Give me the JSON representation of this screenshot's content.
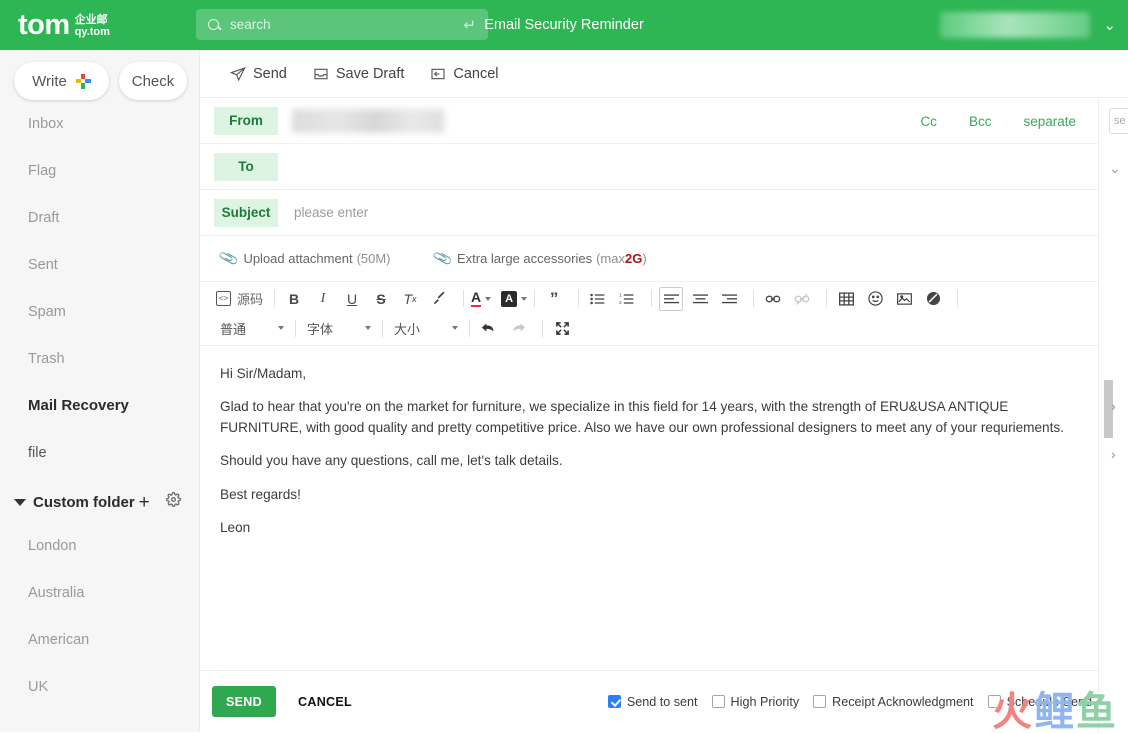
{
  "brand": {
    "logo_word": "tom",
    "logo_line1": "企业邮",
    "logo_line2": "qy.tom",
    "accent_green": "#2eb554",
    "send_green": "#2fa84f",
    "checkbox_blue": "#2a7fff",
    "warn_red": "#b3121a"
  },
  "header": {
    "title": "Email Security Reminder",
    "search_placeholder": "search",
    "search_value": "",
    "search_enter_icon": "enter-arrow-icon",
    "search_icon": "search-icon",
    "account_caret_icon": "chevron-down-icon"
  },
  "sidebar": {
    "write_label": "Write",
    "write_icon": "plus-icon",
    "check_label": "Check",
    "items": [
      {
        "label": "Inbox",
        "style": "muted"
      },
      {
        "label": "Flag",
        "style": "muted"
      },
      {
        "label": "Draft",
        "style": "muted"
      },
      {
        "label": "Sent",
        "style": "muted"
      },
      {
        "label": "Spam",
        "style": "muted"
      },
      {
        "label": "Trash",
        "style": "muted"
      },
      {
        "label": "Mail Recovery",
        "style": "strong"
      },
      {
        "label": "file",
        "style": "dark"
      }
    ],
    "custom_folder": {
      "label": "Custom folder",
      "caret_icon": "triangle-down-icon",
      "add_icon": "plus-icon",
      "settings_icon": "gear-icon",
      "children": [
        {
          "label": "London"
        },
        {
          "label": "Australia"
        },
        {
          "label": "American"
        },
        {
          "label": "UK"
        }
      ]
    }
  },
  "action_bar": {
    "send_label": "Send",
    "send_icon": "paper-plane-icon",
    "save_draft_label": "Save Draft",
    "save_draft_icon": "inbox-tray-icon",
    "cancel_label": "Cancel",
    "cancel_icon": "back-arrow-box-icon"
  },
  "compose": {
    "from_label": "From",
    "from_value": "",
    "to_label": "To",
    "to_value": "",
    "to_placeholder": "",
    "subject_label": "Subject",
    "subject_value": "",
    "subject_placeholder": "please enter",
    "cc_label": "Cc",
    "bcc_label": "Bcc",
    "separate_label": "separate",
    "attachments": {
      "upload_label": "Upload attachment",
      "upload_limit": "(50M)",
      "large_label": "Extra large accessories",
      "large_limit_prefix": "(max ",
      "large_limit_value": "2G",
      "large_limit_suffix": ")",
      "clip_icon": "paperclip-icon"
    }
  },
  "editor_toolbar": {
    "source_label": "源码",
    "source_icon": "code-brackets-icon",
    "buttons": [
      {
        "name": "bold-button",
        "glyph": "B"
      },
      {
        "name": "italic-button",
        "glyph": "I"
      },
      {
        "name": "underline-button",
        "glyph": "U"
      },
      {
        "name": "strikethrough-button",
        "glyph": "S"
      },
      {
        "name": "remove-format-button",
        "glyph": "Tx"
      },
      {
        "name": "format-brush-button",
        "glyph": "brush-icon"
      }
    ],
    "text_color_glyph": "A",
    "bg_color_glyph": "A",
    "quote_glyph": "”",
    "bullet_list_icon": "bullet-list-icon",
    "numbered_list_icon": "numbered-list-icon",
    "align_left_icon": "align-left-icon",
    "align_center_icon": "align-center-icon",
    "align_right_icon": "align-right-icon",
    "link_icon": "link-icon",
    "unlink_icon": "unlink-icon",
    "table_icon": "table-icon",
    "emoji_icon": "smiley-icon",
    "image_icon": "image-icon",
    "no-entry_icon": "circle-slash-icon",
    "undo_icon": "undo-arrow-icon",
    "redo_icon": "redo-arrow-icon",
    "fullscreen_icon": "fullscreen-icon",
    "select_style": "普通",
    "select_font": "字体",
    "select_size": "大小"
  },
  "body": {
    "paragraphs": [
      "Hi Sir/Madam,",
      "Glad to hear that you're on the market for furniture, we specialize in this field for 14 years, with the strength of ERU&USA ANTIQUE FURNITURE, with good quality and pretty competitive price. Also we have our own professional designers to meet any of your requriements.",
      "Should you have any questions, call me, let's talk details.",
      "Best regards!",
      "Leon"
    ]
  },
  "footer": {
    "send_label": "SEND",
    "cancel_label": "CANCEL",
    "options": [
      {
        "label": "Send to sent",
        "checked": true
      },
      {
        "label": "High Priority",
        "checked": false
      },
      {
        "label": "Receipt Acknowledgment",
        "checked": false
      },
      {
        "label": "Schedule Send",
        "checked": false
      }
    ]
  },
  "right_rail": {
    "search_placeholder": "se",
    "caret_icon": "chevron-down-icon",
    "arrow_icon": "chevron-right-icon"
  },
  "watermark": {
    "char1": "火",
    "char2": "鲤",
    "char3": "鱼"
  }
}
